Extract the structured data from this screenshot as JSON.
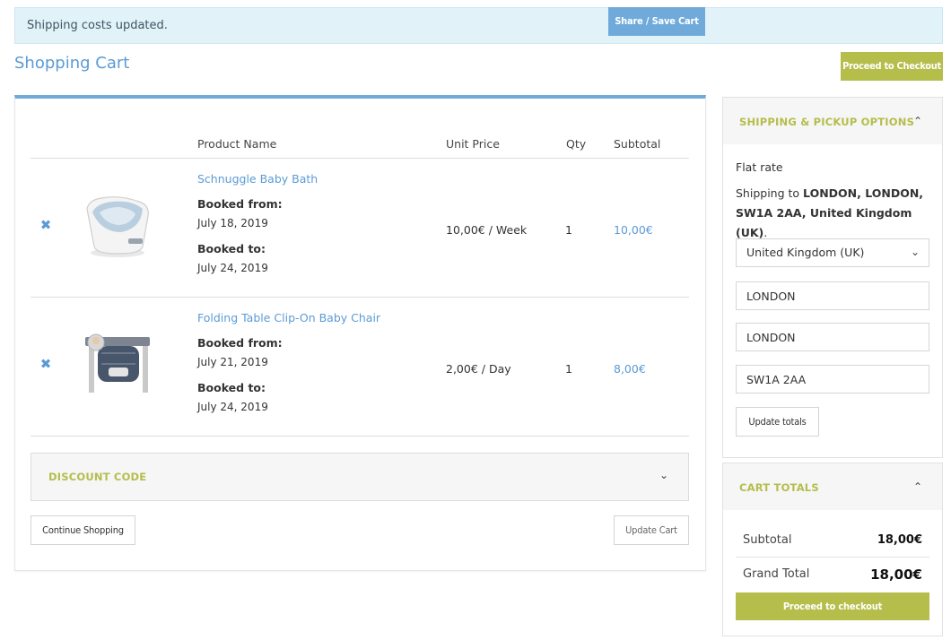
{
  "notice": {
    "text": "Shipping costs updated."
  },
  "share_button": "Share / Save Cart",
  "page_title": "Shopping Cart",
  "checkout_top": "Proceed to Checkout",
  "table": {
    "headers": {
      "product": "Product Name",
      "unit_price": "Unit Price",
      "qty": "Qty",
      "subtotal": "Subtotal"
    },
    "rows": [
      {
        "name": "Schnuggle Baby Bath",
        "booked_from_label": "Booked from:",
        "booked_from": "July 18, 2019",
        "booked_to_label": "Booked to:",
        "booked_to": "July 24, 2019",
        "unit_price": "10,00€ / Week",
        "qty": "1",
        "subtotal": "10,00€"
      },
      {
        "name": "Folding Table Clip-On Baby Chair",
        "booked_from_label": "Booked from:",
        "booked_from": "July 21, 2019",
        "booked_to_label": "Booked to:",
        "booked_to": "July 24, 2019",
        "unit_price": "2,00€ / Day",
        "qty": "1",
        "subtotal": "8,00€"
      }
    ]
  },
  "discount": {
    "title": "DISCOUNT CODE"
  },
  "buttons": {
    "continue": "Continue Shopping",
    "update_cart": "Update Cart"
  },
  "shipping": {
    "title": "SHIPPING & PICKUP OPTIONS",
    "method": "Flat rate",
    "shipping_to_prefix": "Shipping to",
    "destination": "LONDON, LONDON, SW1A 2AA, United Kingdom (UK)",
    "country": "United Kingdom (UK)",
    "city": "LONDON",
    "state": "LONDON",
    "postcode": "SW1A 2AA",
    "update_totals": "Update totals"
  },
  "totals": {
    "title": "CART TOTALS",
    "subtotal_label": "Subtotal",
    "subtotal": "18,00€",
    "grand_label": "Grand Total",
    "grand": "18,00€",
    "checkout": "Proceed to checkout"
  },
  "colors": {
    "link": "#5b9bd5",
    "accent_green": "#b5bd4b",
    "notice_bg": "#e2f2f9"
  }
}
